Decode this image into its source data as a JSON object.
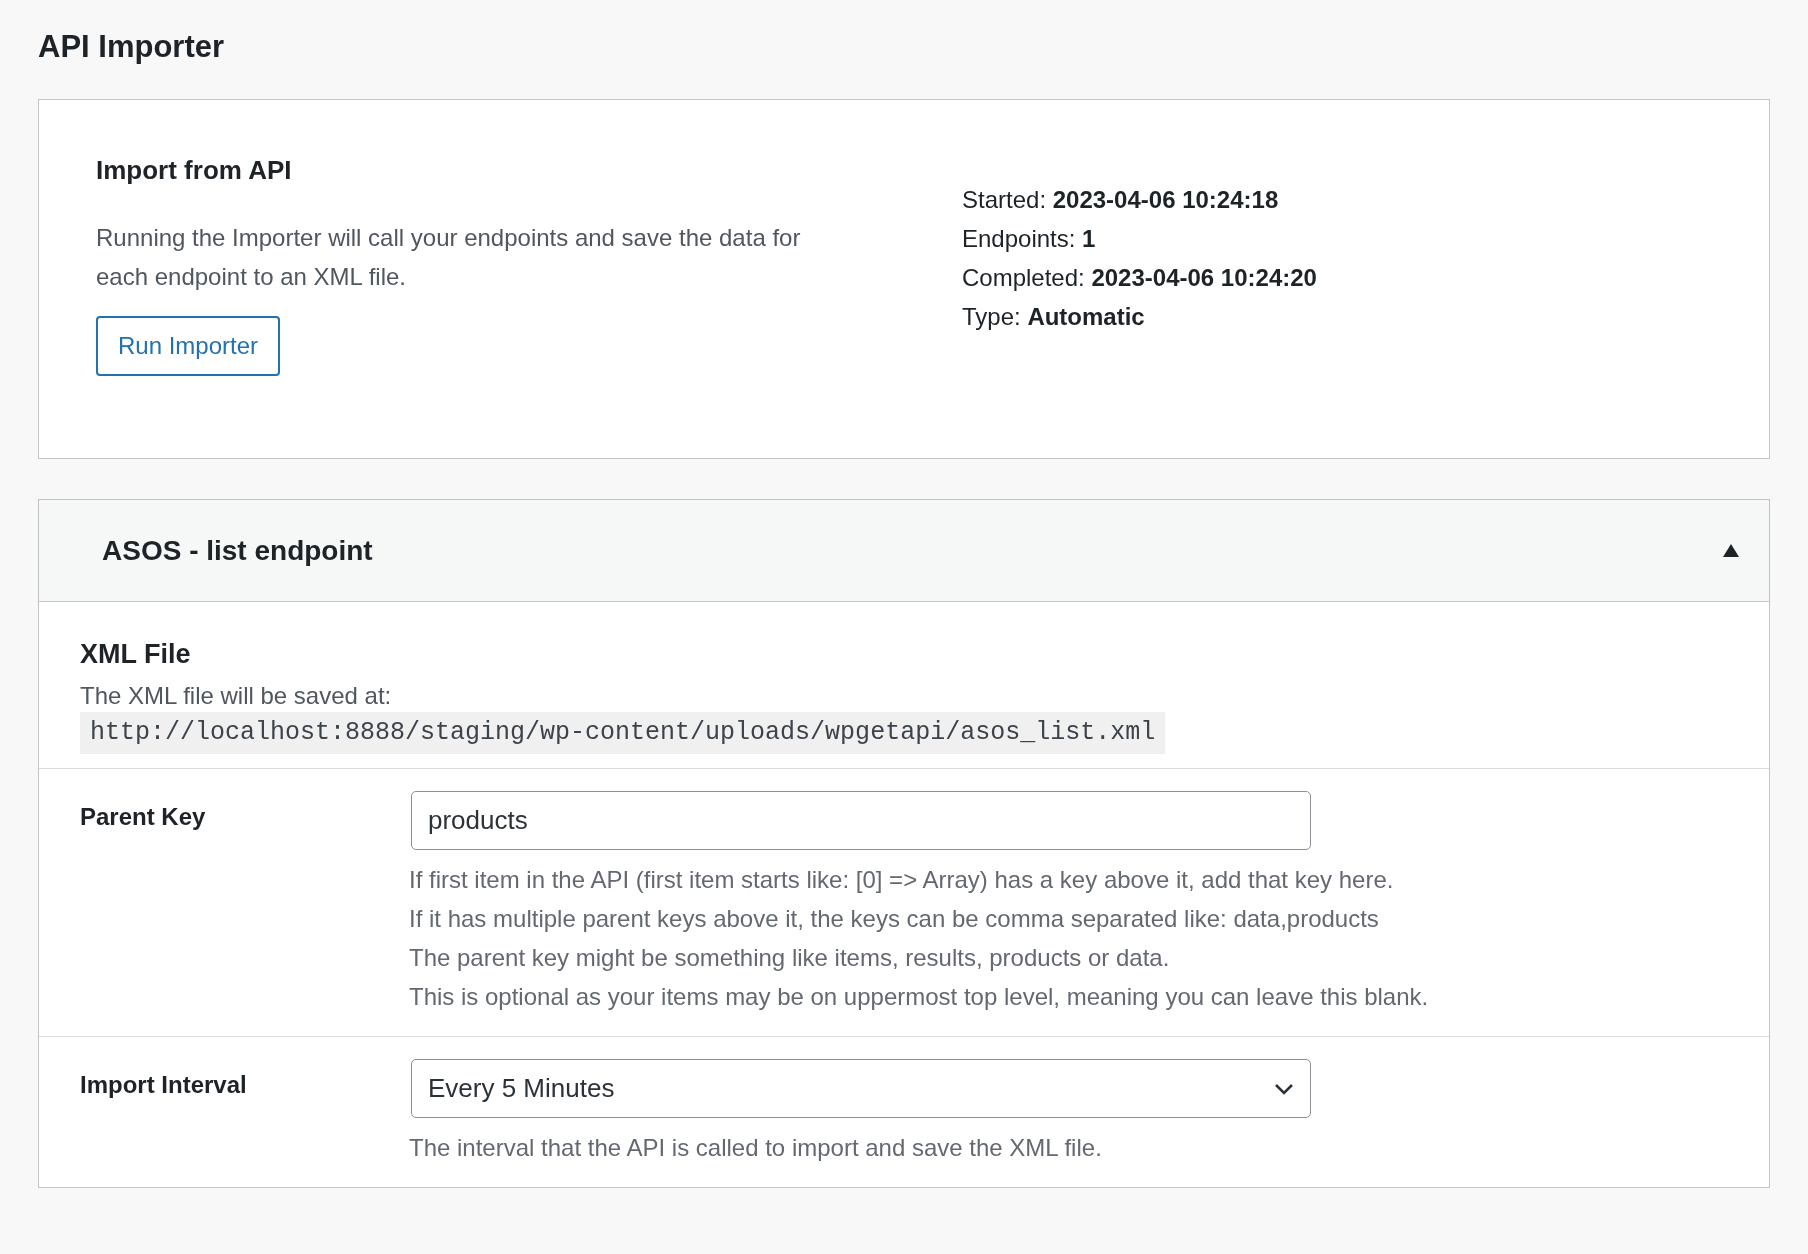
{
  "page_title": "API Importer",
  "import_panel": {
    "heading": "Import from API",
    "description": "Running the Importer will call your endpoints and save the data for each endpoint to an XML file.",
    "button": "Run Importer",
    "stats": [
      {
        "label": "Started:",
        "value": "2023-04-06 10:24:18"
      },
      {
        "label": "Endpoints:",
        "value": "1"
      },
      {
        "label": "Completed:",
        "value": "2023-04-06 10:24:20"
      },
      {
        "label": "Type:",
        "value": "Automatic"
      }
    ]
  },
  "endpoint": {
    "title": "ASOS - list endpoint",
    "expanded": true,
    "xml_file": {
      "heading": "XML File",
      "description": "The XML file will be saved at:",
      "url": "http://localhost:8888/staging/wp-content/uploads/wpgetapi/asos_list.xml"
    },
    "fields": [
      {
        "kind": "text",
        "label": "Parent Key",
        "value": "products",
        "help": [
          "If first item in the API (first item starts like: [0] => Array) has a key above it, add that key here.",
          "If it has multiple parent keys above it, the keys can be comma separated like: data,products",
          "The parent key might be something like items, results, products or data.",
          "This is optional as your items may be on uppermost top level, meaning you can leave this blank."
        ]
      },
      {
        "kind": "select",
        "label": "Import Interval",
        "value": "Every 5 Minutes",
        "help": [
          "The interval that the API is called to import and save the XML file."
        ]
      }
    ]
  }
}
